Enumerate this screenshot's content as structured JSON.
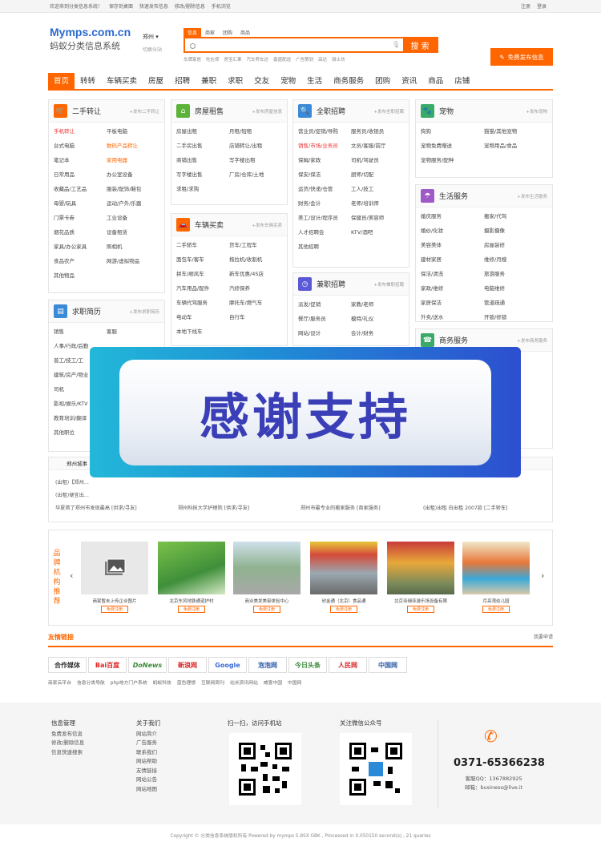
{
  "topbar": {
    "welcome": "欢迎来到分类信息系统！",
    "links": [
      "保存到桌面",
      "快速发布信息",
      "修改/删除信息",
      "手机浏览"
    ],
    "right": [
      "注册",
      "登录"
    ]
  },
  "logo": {
    "domain": "Mymps.com.cn",
    "name": "蚂蚁分类信息系统"
  },
  "city": {
    "name": "郑州",
    "sub": "切换分站"
  },
  "search": {
    "tabs": [
      "信息",
      "商家",
      "团购",
      "商品"
    ],
    "placeholder": "",
    "button": "搜 索",
    "hot": [
      "车牌家居",
      "吃在郑",
      "房宝汇果",
      "汽车养车达",
      "鑫盛配送",
      "广告策划",
      "高达",
      "骑士坊"
    ]
  },
  "post_button": "免费发布信息",
  "nav": [
    {
      "label": "首页",
      "on": true
    },
    {
      "label": "转转"
    },
    {
      "label": "车辆买卖"
    },
    {
      "label": "房屋"
    },
    {
      "label": "招聘"
    },
    {
      "label": "兼职"
    },
    {
      "label": "求职"
    },
    {
      "label": "交友"
    },
    {
      "label": "宠物"
    },
    {
      "label": "生活"
    },
    {
      "label": "商务服务"
    },
    {
      "label": "团购"
    },
    {
      "label": "资讯"
    },
    {
      "label": "商品"
    },
    {
      "label": "店铺"
    }
  ],
  "post_prefix": "+发布",
  "categories": {
    "ershou": {
      "title": "二手转让",
      "post": "+发布二手转让",
      "items": [
        "手机转让",
        "平板电脑",
        "台式电脑",
        "数码产品转让",
        "笔记本",
        "家用电器",
        "日常用品",
        "办公室设备",
        "收藏品/工艺品",
        "服装/配饰/鞋包",
        "母婴/玩具",
        "运动/户外/乐器",
        "门票卡券",
        "工业设备",
        "烟花品质",
        "设备租赁",
        "家具/办公家具",
        "照相机",
        "食品农产",
        "网游/虚拟物品",
        "其他物品"
      ]
    },
    "house": {
      "title": "房屋租售",
      "post": "+发布房屋信息",
      "items": [
        "房屋出租",
        "月租/短租",
        "二手房出售",
        "店铺转让/出租",
        "商铺出售",
        "写字楼出租",
        "写字楼出售",
        "厂房/仓库/土地",
        "求租/求购"
      ]
    },
    "jobs": {
      "title": "全职招聘",
      "post": "+发布全职招聘",
      "items": [
        "营业员/促销/导购",
        "服务员/收银员",
        "销售/市场/业务员",
        "文员/客服/前厅",
        "保姆/家政",
        "司机/驾驶员",
        "保安/保洁",
        "厨师/切配",
        "运货/快递/仓管",
        "工人/技工",
        "财务/会计",
        "老师/培训师",
        "美工/设计/程序员",
        "保健员/美容师",
        "人才招聘会",
        "KTV/酒吧",
        "其他招聘"
      ]
    },
    "pets": {
      "title": "宠物",
      "post": "+发布宠物",
      "items": [
        "狗狗",
        "猫猫/其他宠物",
        "宠物免费赠送",
        "宠物用品/食品",
        "宠物服务/配种"
      ]
    },
    "cars": {
      "title": "车辆买卖",
      "post": "+发布车辆买卖",
      "items": [
        "二手轿车",
        "货车/工程车",
        "面包车/客车",
        "拖拉机/收割机",
        "拼车/顺风车",
        "新车优惠/4S店",
        "汽车用品/配件",
        "汽修保养",
        "车辆代驾服务",
        "摩托车/燃气车",
        "电动车",
        "自行车",
        "本地下线车"
      ]
    },
    "life": {
      "title": "生活服务",
      "post": "+发布生活服务",
      "items": [
        "婚庆服务",
        "搬家/代驾",
        "婚纱/化妆",
        "摄影摄像",
        "美容美体",
        "房屋装修",
        "建材家居",
        "维修/月嫂",
        "保洁/清洗",
        "旅游服务",
        "家政/维修",
        "电脑维修",
        "家居保洁",
        "管道疏通",
        "外卖/送水",
        "开锁/修锁",
        "租车服务",
        "殡葬服务",
        "休闲娱乐",
        "酒店/宾馆",
        "其他生活服务"
      ]
    },
    "resume": {
      "title": "求职简历",
      "post": "+发布求职简历",
      "items": [
        "销售",
        "客服",
        "人事/行政/后勤",
        "",
        "普工/技工/工",
        "",
        "建筑/房产/物业",
        "",
        "司机",
        "",
        "影视/娱乐/KTV",
        "",
        "教育培训/翻译",
        "",
        "其他职位",
        ""
      ]
    },
    "parttime": {
      "title": "兼职招聘",
      "post": "+发布兼职招聘",
      "items": [
        "派发/促销",
        "家教/老师",
        "餐厅/服务员",
        "模特/礼仪",
        "网站/设计",
        "会计/财务"
      ]
    },
    "business": {
      "title": "商务服务",
      "post": "+发布商务服务"
    }
  },
  "overlay_text": "感谢支持",
  "news": {
    "title": "郑州城事",
    "rows": [
      [
        "(出租)【郑州…",
        "",
        "",
        ""
      ],
      [
        "(出租)便宜出…",
        "",
        "",
        ""
      ],
      [
        "华夏首了郑州市发现最高 [供求/寻友]",
        "郑州科技大学护理院 [供求/寻友]",
        "郑州市最专业的搬家服务 [商家服务]",
        "(出租)出租 白出租 2007款 [二手轿车]"
      ]
    ]
  },
  "brand": {
    "label": [
      "品",
      "牌",
      "机",
      "构",
      "推",
      "荐"
    ],
    "items": [
      {
        "caption": "商家暂未上传企业图片",
        "btn": "免费注册"
      },
      {
        "caption": "北京东风地铁通道护村",
        "btn": "免费注册"
      },
      {
        "caption": "商业美发美容体验中心",
        "btn": "免费注册"
      },
      {
        "caption": "欣金通（北京）食品通",
        "btn": "免费注册"
      },
      {
        "caption": "北京亚细亚游乐场设备有限",
        "btn": "免费注册"
      },
      {
        "caption": "月亮湾幼儿园",
        "btn": "免费注册"
      }
    ]
  },
  "friend_links": {
    "title": "友情链接",
    "apply": "我要申请",
    "logos": [
      "合作媒体",
      "Bai百度",
      "DoNews",
      "新浪网",
      "Google",
      "泡泡网",
      "今日头条",
      "人民网",
      "中国网"
    ],
    "text": [
      "商家云平台",
      "信息分类导航",
      "php地方门户系统",
      "蚂蚁科技",
      "蓝色理想",
      "互联网周刊",
      "站长资讯网站",
      "威客中国",
      "中国网"
    ]
  },
  "footer": {
    "cols": [
      {
        "title": "信息管理",
        "items": [
          "免费发布信息",
          "修改/删除信息",
          "信息快速搜索"
        ]
      },
      {
        "title": "关于我们",
        "items": [
          "网站简介",
          "广告服务",
          "联系我们",
          "网站帮助",
          "友情链接",
          "网站公告",
          "网站地图"
        ]
      }
    ],
    "qr1": "扫一扫，访问手机站",
    "qr2": "关注微信公众号",
    "phone": "0371-65366238",
    "qq": "客服QQ：1367882925",
    "email": "邮箱：business@live.it",
    "copyright": "Copyright © 分类信息系统版权所有 Powered by mymps 5.8SX GBK , Processed in 0.050150 second(s) , 21 queries"
  },
  "colors": {
    "accent": "#ff6600",
    "link_blue": "#2a6ad0"
  }
}
